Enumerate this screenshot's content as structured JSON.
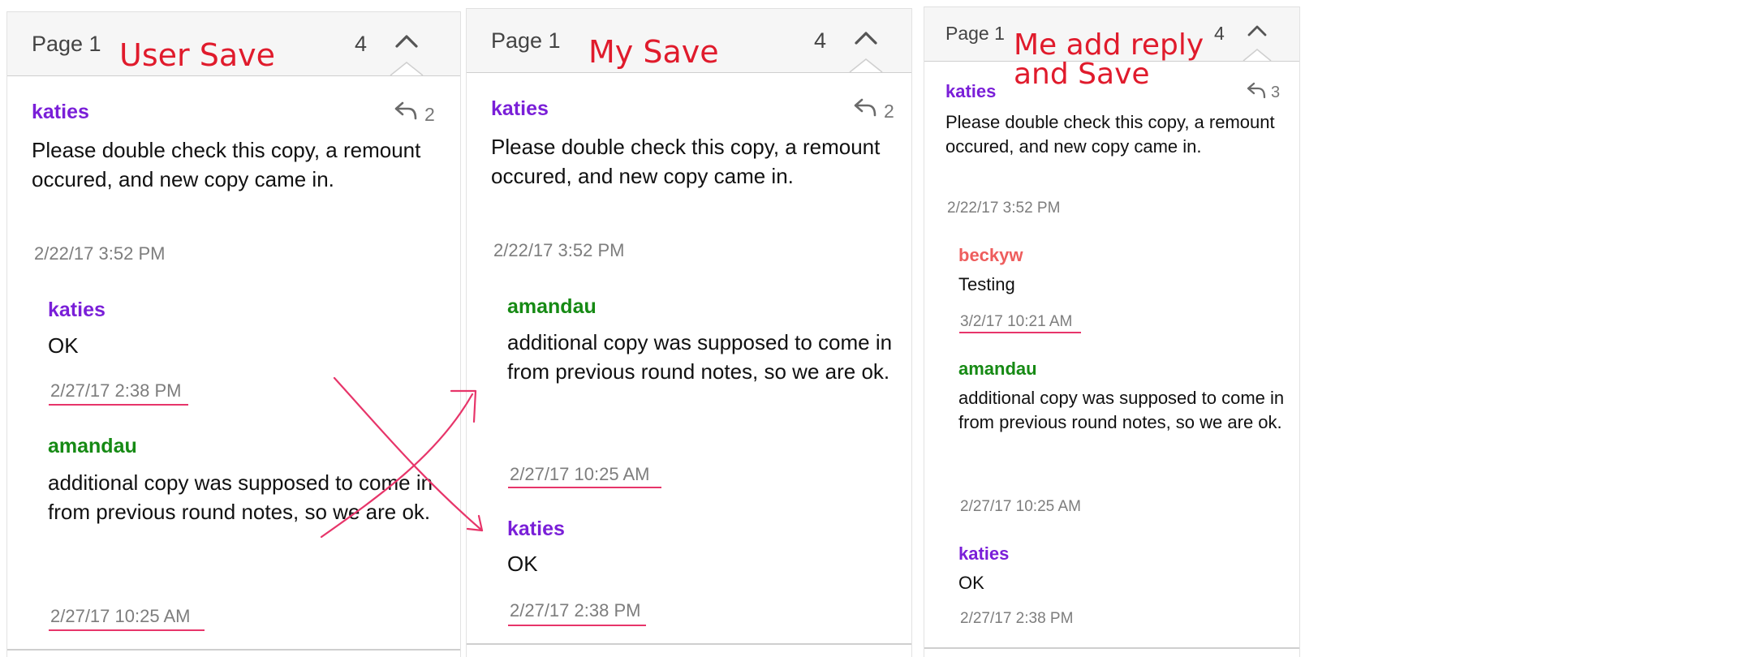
{
  "panels": [
    {
      "page_label": "Page 1",
      "annotation": "User Save",
      "count": "4",
      "comment": {
        "author": "katies",
        "reply_count": "2",
        "text": "Please double check this copy, a remount occured, and new copy came in.",
        "timestamp": "2/22/17  3:52 PM"
      },
      "replies": [
        {
          "author": "katies",
          "text": "OK",
          "timestamp": "2/27/17  2:38 PM"
        },
        {
          "author": "amandau",
          "text": "additional copy was supposed to come in from previous round notes, so we are ok.",
          "timestamp": "2/27/17  10:25 AM"
        }
      ]
    },
    {
      "page_label": "Page 1",
      "annotation": "My Save",
      "count": "4",
      "comment": {
        "author": "katies",
        "reply_count": "2",
        "text": "Please double check this copy, a remount occured, and new copy came in.",
        "timestamp": "2/22/17  3:52 PM"
      },
      "replies": [
        {
          "author": "amandau",
          "text": "additional copy was supposed to come in from previous round notes, so we are ok.",
          "timestamp": "2/27/17  10:25 AM"
        },
        {
          "author": "katies",
          "text": "OK",
          "timestamp": "2/27/17  2:38 PM"
        }
      ]
    },
    {
      "page_label": "Page 1",
      "annotation": "Me add reply and Save",
      "annotation_line1": "Me add reply",
      "annotation_line2": "and Save",
      "count": "4",
      "comment": {
        "author": "katies",
        "reply_count": "3",
        "text": "Please double check this copy, a remount occured, and new copy came in.",
        "timestamp": "2/22/17  3:52 PM"
      },
      "replies": [
        {
          "author": "beckyw",
          "text": "Testing",
          "timestamp": "3/2/17  10:21 AM"
        },
        {
          "author": "amandau",
          "text": "additional copy was supposed to come in from previous round notes, so we are ok.",
          "timestamp": "2/27/17  10:25 AM"
        },
        {
          "author": "katies",
          "text": "OK",
          "timestamp": "2/27/17  2:38 PM"
        }
      ]
    }
  ],
  "colors": {
    "annotation": "#e01b2c",
    "underline": "#e7356a",
    "author_katies": "#7a1fd8",
    "author_amandau": "#168a14",
    "author_beckyw": "#ee5d5d",
    "timestamp": "#7d7d7d"
  },
  "icons": {
    "collapse": "chevron-up-icon",
    "reply": "reply-arrow-icon"
  }
}
